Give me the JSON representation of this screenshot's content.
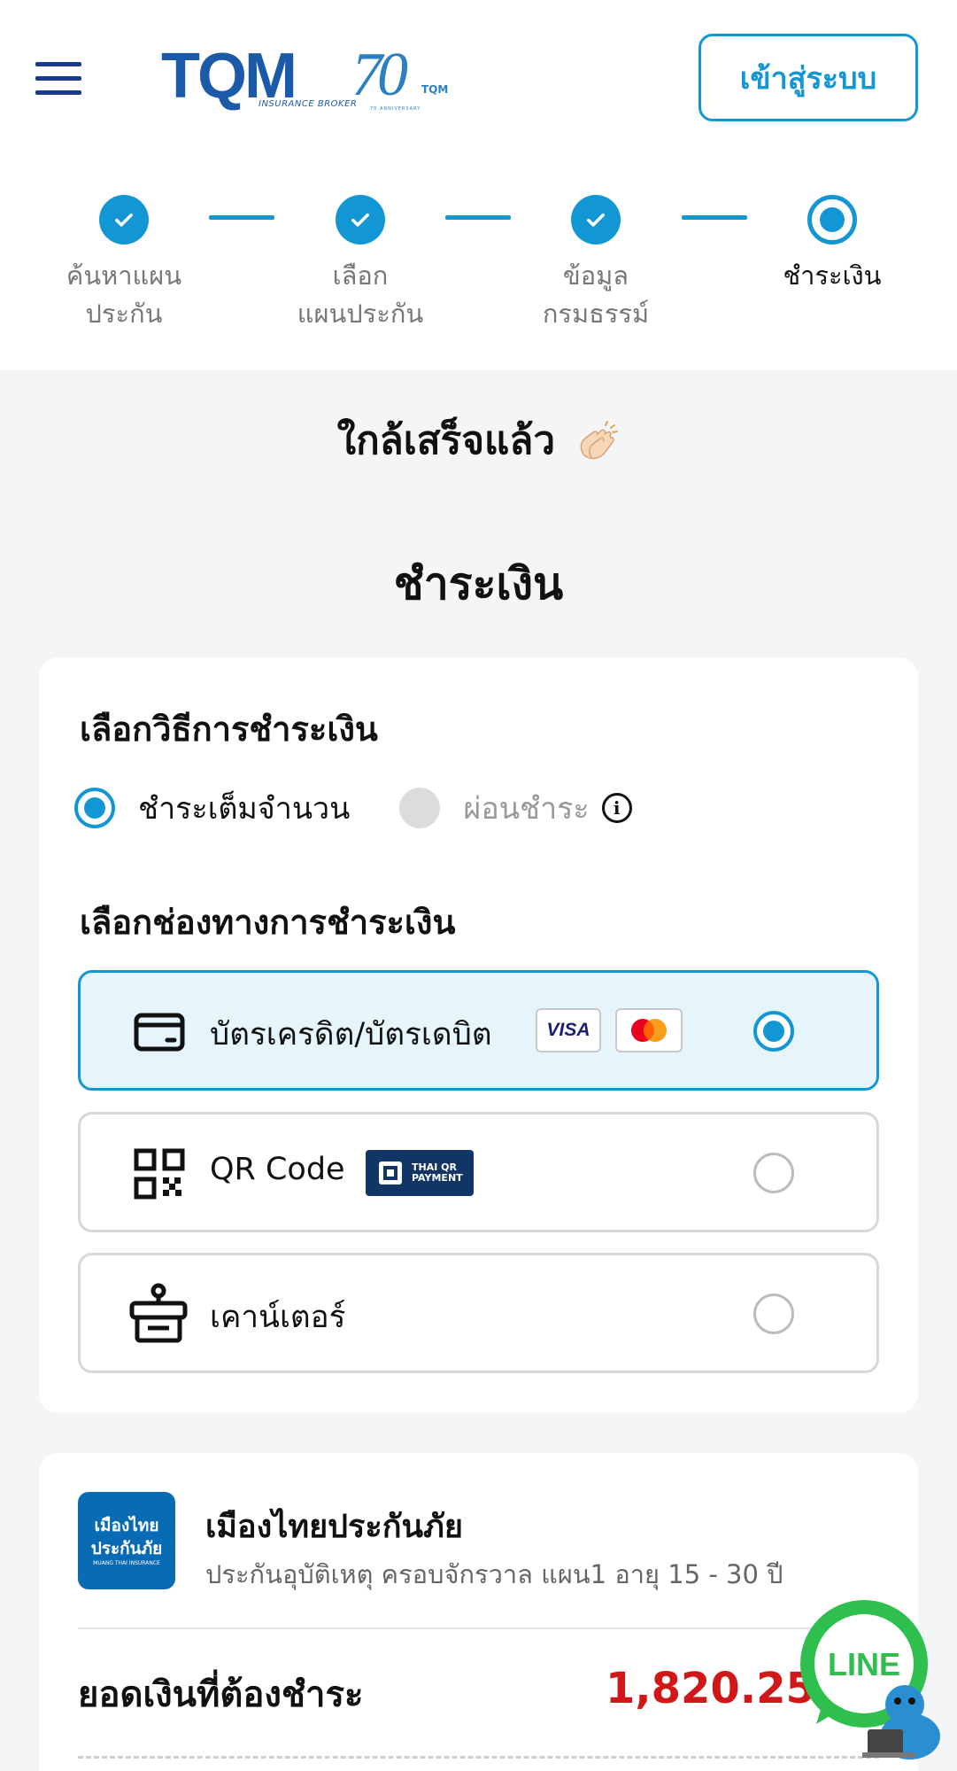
{
  "header": {
    "brand": "TQM",
    "brand_sub": "INSURANCE BROKER",
    "anniversary": "70",
    "anniversary_sub": "TQM",
    "anniversary_caption": "70 ANNIVERSARY",
    "login_label": "เข้าสู่ระบบ"
  },
  "stepper": {
    "steps": [
      {
        "line1": "ค้นหาแผน",
        "line2": "ประกัน",
        "state": "done"
      },
      {
        "line1": "เลือก",
        "line2": "แผนประกัน",
        "state": "done"
      },
      {
        "line1": "ข้อมูล",
        "line2": "กรมธรรม์",
        "state": "done"
      },
      {
        "line1": "ชำระเงิน",
        "line2": "",
        "state": "current"
      }
    ]
  },
  "page": {
    "almost_done": "ใกล้เสร็จแล้ว",
    "title": "ชำระเงิน"
  },
  "payment": {
    "type_heading": "เลือกวิธีการชำระเงิน",
    "full_label": "ชำระเต็มจำนวน",
    "installment_label": "ผ่อนชำระ",
    "channel_heading": "เลือกช่องทางการชำระเงิน",
    "methods": [
      {
        "label": "บัตรเครดิต/บัตรเดบิต",
        "badge": "VISA",
        "selected": true
      },
      {
        "label": "QR Code",
        "badge": "THAI QR PAYMENT",
        "selected": false
      },
      {
        "label": "เคาน์เตอร์",
        "selected": false
      }
    ]
  },
  "summary": {
    "insurer_logo_line1": "เมืองไทย",
    "insurer_logo_line2": "ประกันภัย",
    "insurer_logo_tagline": "MUANG THAI INSURANCE",
    "insurer_name": "เมืองไทยประกันภัย",
    "plan": "ประกันอุบัติเหตุ ครอบจักรวาล แผน1 อายุ 15 - 30 ปี",
    "amount_label": "ยอดเงินที่ต้องชำระ",
    "amount": "1,820.25 ฿"
  },
  "line_chat": {
    "label": "LINE"
  },
  "colors": {
    "primary": "#1397d4",
    "navy": "#1b3a8c",
    "amount": "#d01818",
    "selected_bg": "#e6f5fc"
  }
}
